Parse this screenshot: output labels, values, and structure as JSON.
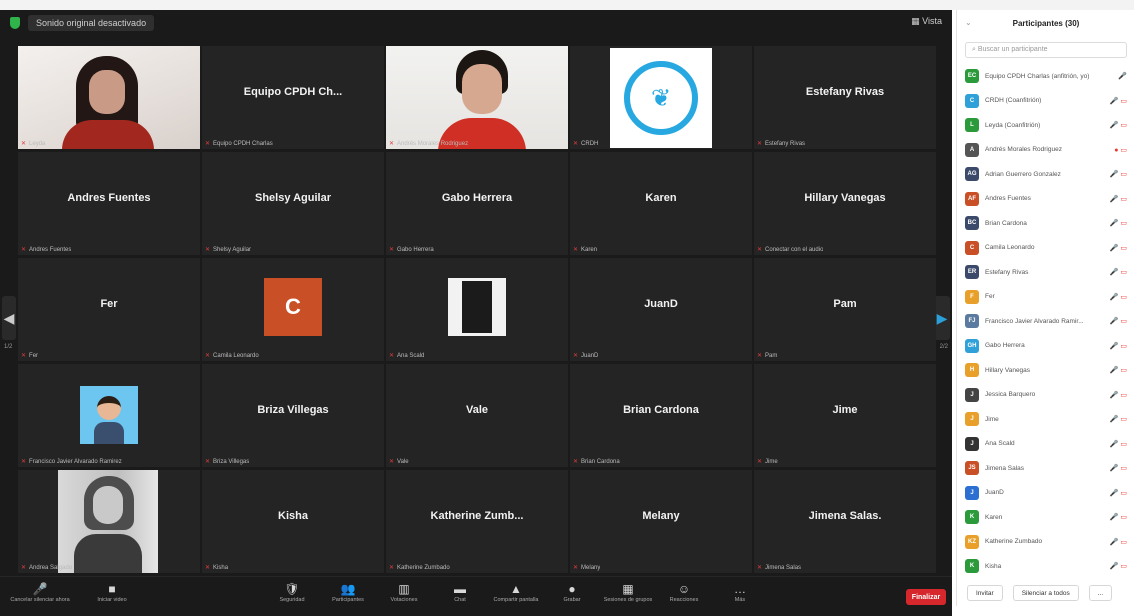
{
  "meeting": {
    "original_sound": "Sonido original desactivado",
    "view_label": "Vista"
  },
  "tiles": [
    {
      "kind": "cam-a",
      "label": "Leyda"
    },
    {
      "kind": "name",
      "name": "Equipo CPDH Ch...",
      "label": "Equipo CPDH Charlas"
    },
    {
      "kind": "cam-b",
      "label": "Andrés Morales Rodriguez",
      "active": true
    },
    {
      "kind": "logo",
      "label": "CRDH"
    },
    {
      "kind": "name",
      "name": "Estefany Rivas",
      "label": "Estefany Rivas"
    },
    {
      "kind": "name",
      "name": "Andres Fuentes",
      "label": "Andres Fuentes"
    },
    {
      "kind": "name",
      "name": "Shelsy Aguilar",
      "label": "Shelsy Aguilar"
    },
    {
      "kind": "name",
      "name": "Gabo Herrera",
      "label": "Gabo Herrera"
    },
    {
      "kind": "name",
      "name": "Karen",
      "label": "Karen"
    },
    {
      "kind": "name",
      "name": "Hillary Vanegas",
      "label": "Conectar con el audio"
    },
    {
      "kind": "name",
      "name": "Fer",
      "label": "Fer"
    },
    {
      "kind": "c",
      "letter": "C",
      "label": "Camila Leonardo"
    },
    {
      "kind": "photo",
      "label": "Ana Scald"
    },
    {
      "kind": "name",
      "name": "JuanD",
      "label": "JuanD"
    },
    {
      "kind": "name",
      "name": "Pam",
      "label": "Pam"
    },
    {
      "kind": "cartoon",
      "label": "Francisco Javier Alvarado Ramirez"
    },
    {
      "kind": "name",
      "name": "Briza Villegas",
      "label": "Briza Villegas"
    },
    {
      "kind": "name",
      "name": "Vale",
      "label": "Vale"
    },
    {
      "kind": "name",
      "name": "Brian Cardona",
      "label": "Brian Cardona"
    },
    {
      "kind": "name",
      "name": "Jime",
      "label": "Jime"
    },
    {
      "kind": "bw",
      "label": "Andrea Salgado"
    },
    {
      "kind": "name",
      "name": "Kisha",
      "label": "Kisha"
    },
    {
      "kind": "name",
      "name": "Katherine Zumb...",
      "label": "Katherine Zumbado"
    },
    {
      "kind": "name",
      "name": "Melany",
      "label": "Melany"
    },
    {
      "kind": "name",
      "name": "Jimena Salas.",
      "label": "Jimena Salas"
    }
  ],
  "pages": {
    "left": "1/2",
    "right": "2/2"
  },
  "toolbar": {
    "left": [
      {
        "icon": "🎤",
        "label": "Cancelar silenciar ahora"
      },
      {
        "icon": "■",
        "label": "Iniciar video"
      }
    ],
    "center": [
      {
        "icon": "🛡",
        "label": "Seguridad"
      },
      {
        "icon": "👥",
        "label": "Participantes"
      },
      {
        "icon": "▥",
        "label": "Votaciones"
      },
      {
        "icon": "▬",
        "label": "Chat"
      },
      {
        "icon": "▲",
        "label": "Compartir pantalla"
      },
      {
        "icon": "●",
        "label": "Grabar"
      },
      {
        "icon": "▦",
        "label": "Sesiones de grupos"
      },
      {
        "icon": "☺",
        "label": "Reacciones"
      },
      {
        "icon": "…",
        "label": "Más"
      }
    ],
    "end": "Finalizar"
  },
  "panel": {
    "title": "Participantes (30)",
    "search_placeholder": "Buscar un participante",
    "participants": [
      {
        "initials": "EC",
        "color": "#2a9a3a",
        "name": "Equipo CPDH Charlas (anfitrión, yo)",
        "status": "🎤"
      },
      {
        "initials": "C",
        "color": "#2fa0d8",
        "name": "CRDH (Coanfitrión)",
        "status": "🎤 ▭"
      },
      {
        "initials": "L",
        "color": "#2a9a3a",
        "name": "Leyda (Coanfitrión)",
        "status": "🎤 ▭"
      },
      {
        "initials": "A",
        "color": "#555555",
        "name": "Andrés Morales Rodriguez",
        "status": "● ▭"
      },
      {
        "initials": "AG",
        "color": "#3b4a6b",
        "name": "Adrian Guerrero Gonzalez",
        "status": "🎤 ▭"
      },
      {
        "initials": "AF",
        "color": "#c94f26",
        "name": "Andres Fuentes",
        "status": "🎤 ▭"
      },
      {
        "initials": "BC",
        "color": "#3b4a6b",
        "name": "Brian Cardona",
        "status": "🎤 ▭"
      },
      {
        "initials": "C",
        "color": "#c94f26",
        "name": "Camila Leonardo",
        "status": "🎤 ▭"
      },
      {
        "initials": "ER",
        "color": "#3b4a6b",
        "name": "Estefany Rivas",
        "status": "🎤 ▭"
      },
      {
        "initials": "F",
        "color": "#e8a02a",
        "name": "Fer",
        "status": "🎤 ▭"
      },
      {
        "initials": "FJ",
        "color": "#5a7aa0",
        "name": "Francisco Javier Alvarado Ramir...",
        "status": "🎤 ▭"
      },
      {
        "initials": "GH",
        "color": "#2fa0d8",
        "name": "Gabo Herrera",
        "status": "🎤 ▭"
      },
      {
        "initials": "H",
        "color": "#e8a02a",
        "name": "Hillary Vanegas",
        "status": "🎤 ▭"
      },
      {
        "initials": "J",
        "color": "#444444",
        "name": "Jessica Barquero",
        "status": "🎤 ▭"
      },
      {
        "initials": "J",
        "color": "#e8a02a",
        "name": "Jime",
        "status": "🎤 ▭"
      },
      {
        "initials": "J",
        "color": "#333333",
        "name": "Ana Scald",
        "status": "🎤 ▭"
      },
      {
        "initials": "JS",
        "color": "#c94f26",
        "name": "Jimena Salas",
        "status": "🎤 ▭"
      },
      {
        "initials": "J",
        "color": "#2a6fd1",
        "name": "JuanD",
        "status": "🎤 ▭"
      },
      {
        "initials": "K",
        "color": "#2a9a3a",
        "name": "Karen",
        "status": "🎤 ▭"
      },
      {
        "initials": "KZ",
        "color": "#e8a02a",
        "name": "Katherine Zumbado",
        "status": "🎤 ▭"
      },
      {
        "initials": "K",
        "color": "#2a9a3a",
        "name": "Kisha",
        "status": "🎤 ▭"
      }
    ],
    "invite": "Invitar",
    "mute_all": "Silenciar a todos",
    "more": "..."
  }
}
